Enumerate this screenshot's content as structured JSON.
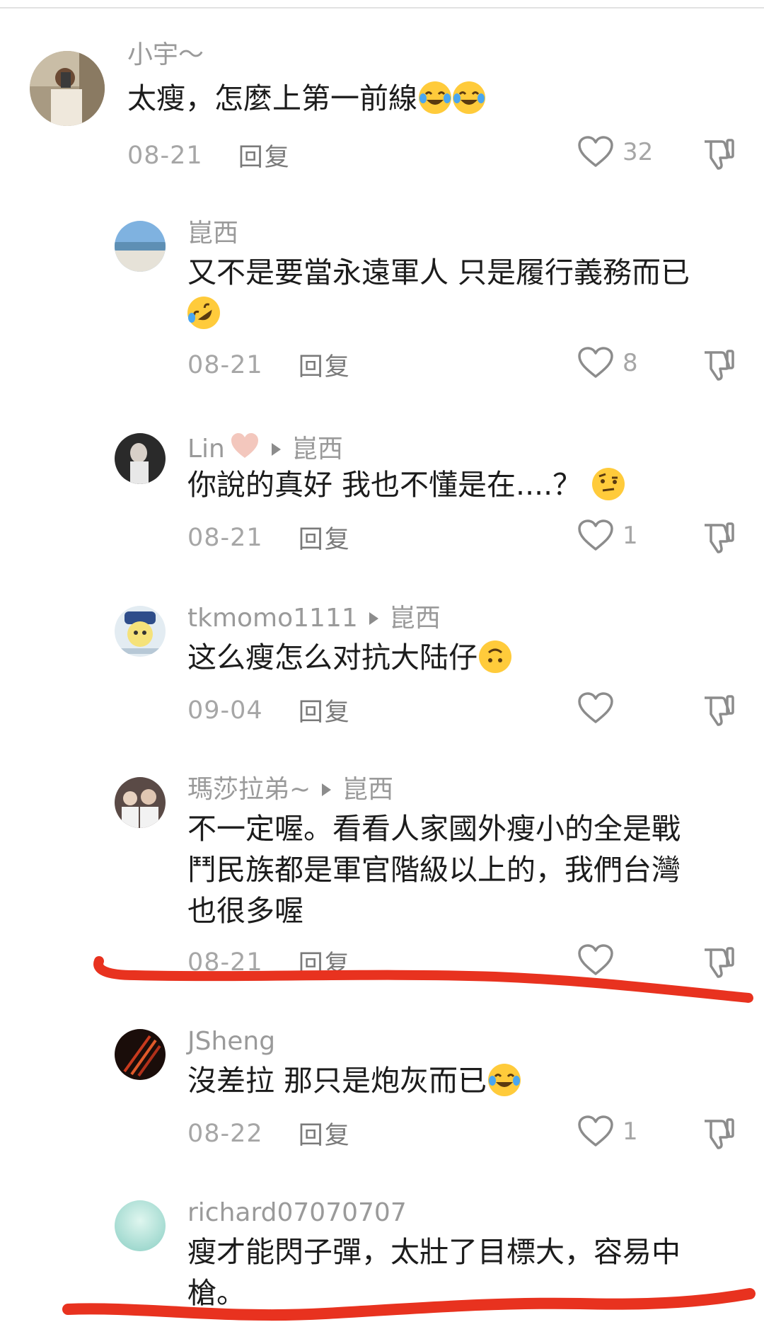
{
  "comments": [
    {
      "user": "小宇～",
      "text": "太瘦，怎麼上第一前線",
      "date": "08-21",
      "reply_label": "回复",
      "likes": "32"
    },
    {
      "user": "崑西",
      "text_line1": "又不是要當永遠軍人 只是履行義務而已",
      "date": "08-21",
      "reply_label": "回复",
      "likes": "8"
    },
    {
      "user": "Lin",
      "reply_to": "崑西",
      "text": "你說的真好 我也不懂是在....？",
      "date": "08-21",
      "reply_label": "回复",
      "likes": "1"
    },
    {
      "user": "tkmomo1111",
      "reply_to": "崑西",
      "text": "这么瘦怎么对抗大陆仔",
      "date": "09-04",
      "reply_label": "回复",
      "likes": ""
    },
    {
      "user": "瑪莎拉弟~",
      "reply_to": "崑西",
      "text_line1": "不一定喔。看看人家國外瘦小的全是戰",
      "text_line2": "鬥民族都是軍官階級以上的，我們台灣",
      "text_line3": "也很多喔",
      "date": "08-21",
      "reply_label": "回复",
      "likes": ""
    },
    {
      "user": "JSheng",
      "text": "沒差拉 那只是炮灰而已",
      "date": "08-22",
      "reply_label": "回复",
      "likes": "1"
    },
    {
      "user": "richard07070707",
      "text_line1": "瘦才能閃子彈，太壯了目標大，容易中",
      "text_line2": "槍。"
    }
  ],
  "colors": {
    "annotation_red": "#e8321f",
    "text": "#1c1c1c",
    "meta": "#a6a6a6",
    "icon": "#8c8c8c"
  },
  "icons": [
    "heart-outline-icon",
    "thumbs-down-icon",
    "tear-joy-emoji",
    "rofl-emoji",
    "raised-eyebrow-emoji",
    "upside-down-face-emoji",
    "pink-heart-emoji"
  ]
}
